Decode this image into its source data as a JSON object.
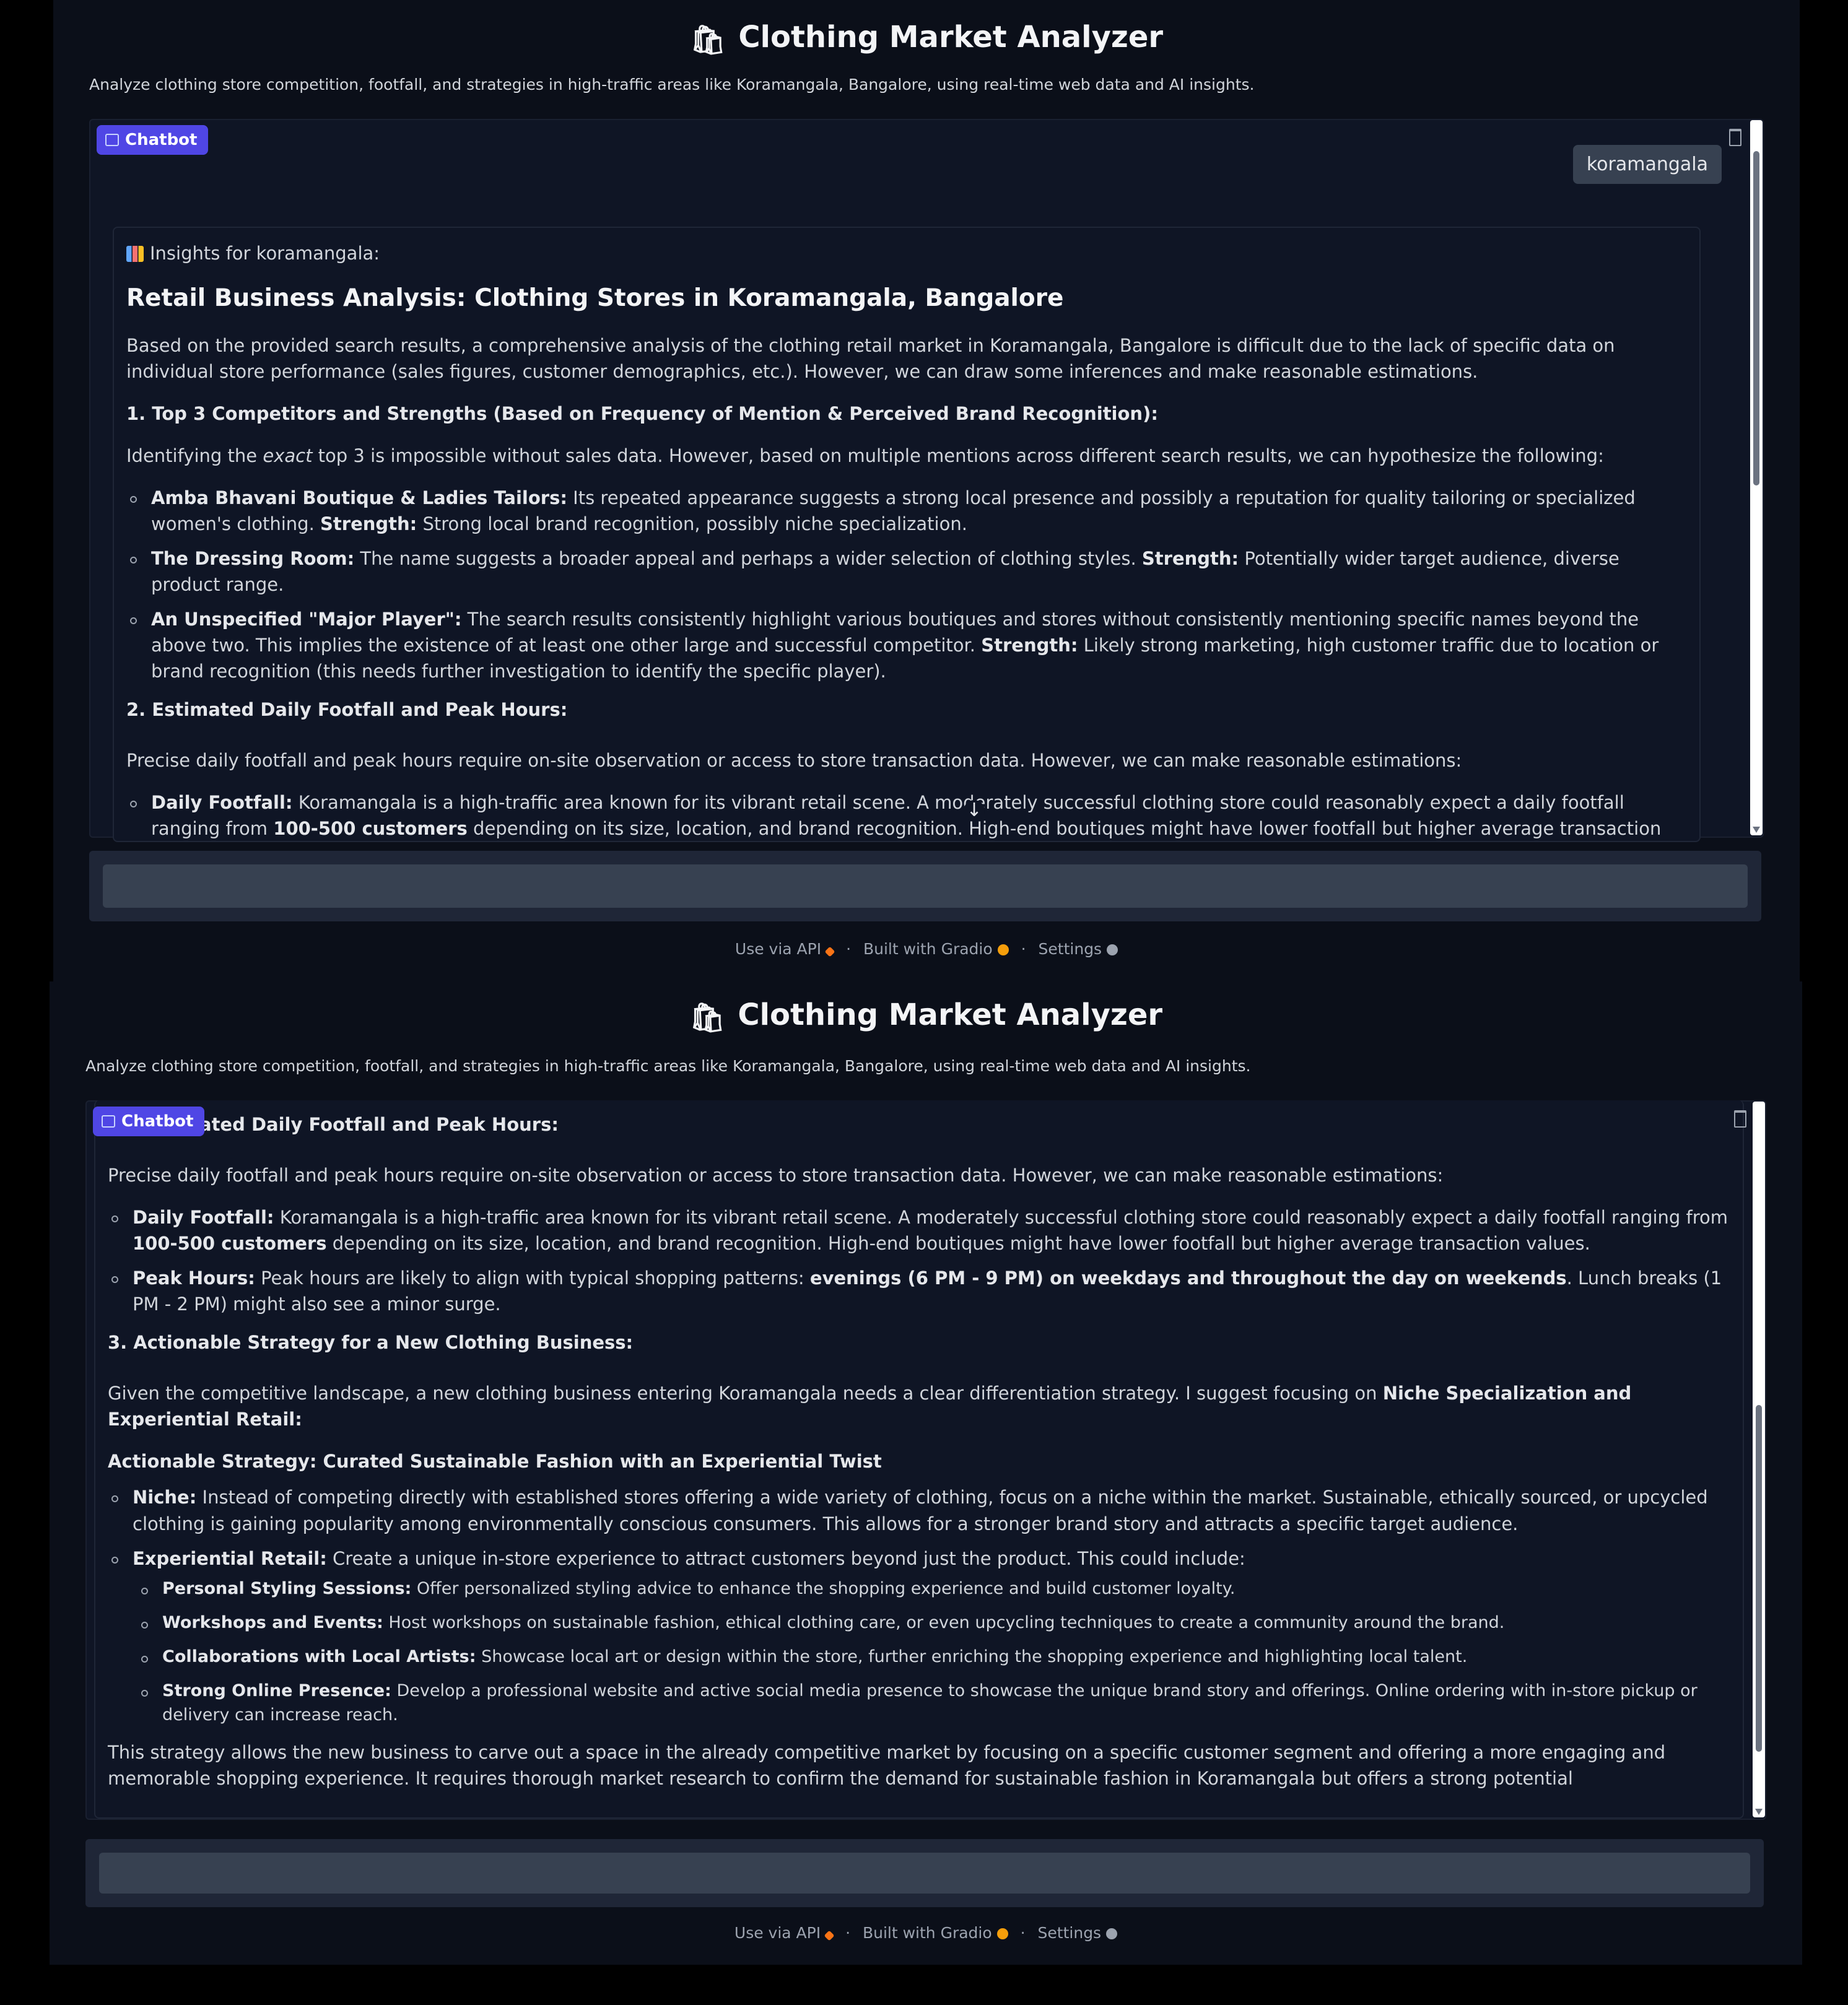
{
  "app": {
    "title": "Clothing Market Analyzer",
    "title_icon": "shopping-bags-icon",
    "description": "Analyze clothing store competition, footfall, and strategies in high-traffic areas like Koramangala, Bangalore, using real-time web data and AI insights."
  },
  "chatbot": {
    "label": "Chatbot",
    "user_message": "koramangala"
  },
  "input": {
    "value": "",
    "placeholder": ""
  },
  "footer": {
    "api": "Use via API",
    "built": "Built with Gradio",
    "settings": "Settings",
    "sep": "·"
  },
  "response": {
    "insights_header": "Insights for koramangala:",
    "heading": "Retail Business Analysis: Clothing Stores in Koramangala, Bangalore",
    "intro": "Based on the provided search results, a comprehensive analysis of the clothing retail market in Koramangala, Bangalore is difficult due to the lack of specific data on individual store performance (sales figures, customer demographics, etc.). However, we can draw some inferences and make reasonable estimations.",
    "s1_title": "1. Top 3 Competitors and Strengths (Based on Frequency of Mention & Perceived Brand Recognition):",
    "s1_intro_a": "Identifying the ",
    "s1_intro_em": "exact",
    "s1_intro_b": " top 3 is impossible without sales data. However, based on multiple mentions across different search results, we can hypothesize the following:",
    "c1_name": "Amba Bhavani Boutique & Ladies Tailors:",
    "c1_text": " Its repeated appearance suggests a strong local presence and possibly a reputation for quality tailoring or specialized women's clothing. ",
    "c1_strength_label": "Strength:",
    "c1_strength": " Strong local brand recognition, possibly niche specialization.",
    "c2_name": "The Dressing Room:",
    "c2_text": " The name suggests a broader appeal and perhaps a wider selection of clothing styles. ",
    "c2_strength_label": "Strength:",
    "c2_strength": " Potentially wider target audience, diverse product range.",
    "c3_name": "An Unspecified \"Major Player\":",
    "c3_text": " The search results consistently highlight various boutiques and stores without consistently mentioning specific names beyond the above two. This implies the existence of at least one other large and successful competitor. ",
    "c3_strength_label": "Strength:",
    "c3_strength": " Likely strong marketing, high customer traffic due to location or brand recognition (this needs further investigation to identify the specific player).",
    "s2_title": "2. Estimated Daily Footfall and Peak Hours:",
    "s2_title_clipped": "ated Daily Footfall and Peak Hours:",
    "s2_intro": "Precise daily footfall and peak hours require on-site observation or access to store transaction data. However, we can make reasonable estimations:",
    "f1_label": "Daily Footfall:",
    "f1_text_a": " Koramangala is a high-traffic area known for its vibrant retail scene. A moderately successful clothing store could reasonably expect a daily footfall ranging from ",
    "f1_bold": "100-500 customers",
    "f1_text_b": " depending on its size, location, and brand recognition. High-end boutiques might have lower footfall but higher average transaction values.",
    "f2_label": "Peak Hours:",
    "f2_text_a": " Peak hours are likely to align with typical shopping patterns: ",
    "f2_bold": "evenings (6 PM - 9 PM) on weekdays and throughout the day on weekends",
    "f2_text_b": ". Lunch breaks (1 PM - 2 PM) might also see a minor surge.",
    "s3_title": "3. Actionable Strategy for a New Clothing Business:",
    "s3_intro_a": "Given the competitive landscape, a new clothing business entering Koramangala needs a clear differentiation strategy. I suggest focusing on ",
    "s3_intro_bold": "Niche Specialization and Experiential Retail:",
    "strategy_title": "Actionable Strategy: Curated Sustainable Fashion with an Experiential Twist",
    "n_label": "Niche:",
    "n_text": " Instead of competing directly with established stores offering a wide variety of clothing, focus on a niche within the market. Sustainable, ethically sourced, or upcycled clothing is gaining popularity among environmentally conscious consumers. This allows for a stronger brand story and attracts a specific target audience.",
    "e_label": "Experiential Retail:",
    "e_text": " Create a unique in-store experience to attract customers beyond just the product. This could include:",
    "sub1_label": "Personal Styling Sessions:",
    "sub1_text": " Offer personalized styling advice to enhance the shopping experience and build customer loyalty.",
    "sub2_label": "Workshops and Events:",
    "sub2_text": " Host workshops on sustainable fashion, ethical clothing care, or even upcycling techniques to create a community around the brand.",
    "sub3_label": "Collaborations with Local Artists:",
    "sub3_text": " Showcase local art or design within the store, further enriching the shopping experience and highlighting local talent.",
    "sub4_label": "Strong Online Presence:",
    "sub4_text": " Develop a professional website and active social media presence to showcase the unique brand story and offerings. Online ordering with in-store pickup or delivery can increase reach.",
    "closing": "This strategy allows the new business to carve out a space in the already competitive market by focusing on a specific customer segment and offering a more engaging and memorable shopping experience. It requires thorough market research to confirm the demand for sustainable fashion in Koramangala but offers a strong potential"
  }
}
